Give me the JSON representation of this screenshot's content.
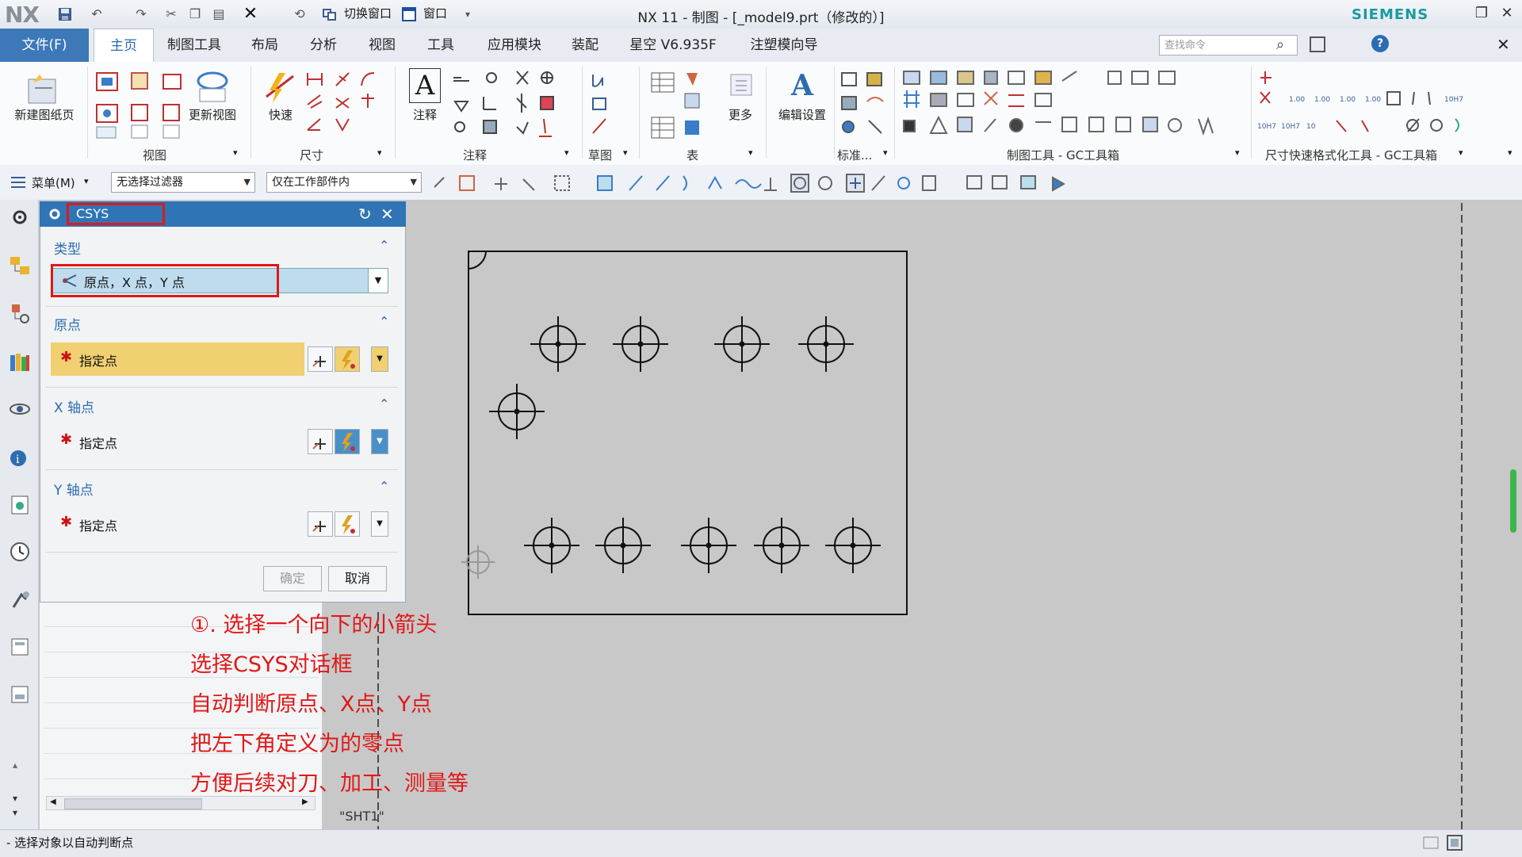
{
  "titlebar": {
    "logo": "NX",
    "switch_window": "切换窗口",
    "window_menu": "窗口",
    "title": "NX 11 - 制图 - [_model9.prt（修改的）]",
    "brand": "SIEMENS"
  },
  "tabs": {
    "file": "文件(F)",
    "items": [
      "主页",
      "制图工具",
      "布局",
      "分析",
      "视图",
      "工具",
      "应用模块",
      "装配",
      "星空 V6.935F",
      "注塑模向导"
    ],
    "active": "主页"
  },
  "search": {
    "placeholder": "查找命令"
  },
  "ribbon": {
    "new_sheet": "新建图纸页",
    "update_view": "更新视图",
    "quick": "快速",
    "annotation": "注释",
    "more": "更多",
    "edit_settings": "编辑设置",
    "groups": {
      "view": "视图",
      "dimension": "尺寸",
      "annotation": "注释",
      "sketch": "草图",
      "table": "表",
      "standard": "标准...",
      "drafting_tools": "制图工具 - GC工具箱",
      "dim_format": "尺寸快速格式化工具 - GC工具箱"
    }
  },
  "cmdbar": {
    "menu": "菜单(M)",
    "filter": "无选择过滤器",
    "scope": "仅在工作部件内"
  },
  "dialog": {
    "title": "CSYS",
    "sections": {
      "type": "类型",
      "origin": "原点",
      "x_axis": "X 轴点",
      "y_axis": "Y 轴点"
    },
    "type_value": "原点，X 点，Y 点",
    "specify_point": "指定点",
    "ok": "确定",
    "cancel": "取消"
  },
  "annotations": [
    "①. 选择一个向下的小箭头",
    "选择CSYS对话框",
    "自动判断原点、X点、Y点",
    "把左下角定义为的零点",
    "方便后续对刀、加工、测量等"
  ],
  "canvas": {
    "sheet_name": "\"SHT1\""
  },
  "status": {
    "text": "- 选择对象以自动判断点"
  },
  "colors": {
    "accent": "#2f74b5",
    "highlight_red": "#e01818",
    "required_field": "#f0d070"
  }
}
